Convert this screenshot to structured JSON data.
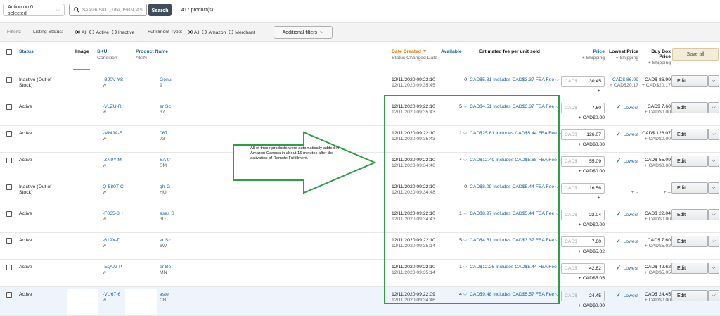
{
  "toolbar": {
    "action_dropdown": "Action on 0 selected",
    "search_placeholder": "Search SKU, Title, ISBN, AS",
    "search_button": "Search",
    "product_count": "417 product(s)"
  },
  "filters": {
    "label": "Filters:",
    "listing_status_label": "Listing Status:",
    "listing_options": [
      "All",
      "Active",
      "Inactive"
    ],
    "listing_selected": "All",
    "fulfillment_label": "Fulfillment Type:",
    "fulfillment_options": [
      "All",
      "Amazon",
      "Merchant"
    ],
    "fulfillment_selected": "All",
    "additional_filters": "Additional filters"
  },
  "columns": {
    "status": "Status",
    "image": "Image",
    "sku": "SKU",
    "sku_sub": "Condition",
    "product_name": "Product Name",
    "product_name_sub": "ASIN",
    "date_created": "Date Created",
    "date_created_sub": "Status Changed Date",
    "available": "Available",
    "fee": "Estimated fee per unit sold",
    "price": "Price",
    "price_sub": "+ Shipping",
    "lowest_price": "Lowest Price",
    "lowest_price_sub": "+ Shipping",
    "buy_box": "Buy Box Price",
    "buy_box_sub": "+ Shipping",
    "save_all": "Save all"
  },
  "annotation": "All of these products were automatically added in Amazon Canada in about 15 minutes after the activation of Remote Fulfillment.",
  "currency_placeholder": "CAD$",
  "edit_label": "Edit",
  "rows": [
    {
      "status": "Inactive (Out of Stock)",
      "sku": "-BJ0V-YS",
      "cond": "w",
      "name": "Genu",
      "asin": "9",
      "date": "12/11/2020 09:22:10",
      "changed": "12/11/2020 09:35:45",
      "avail": "0",
      "fee": "CAD$5.81 Includes CAD$3.37 FBA Fee",
      "price": "30.45",
      "ship": "+ --",
      "lowest": "CAD$ 86.99",
      "lowest_ship": "+ CAD$20.17",
      "buybox": "CAD$ 86.99",
      "buybox_ship": "+ CAD$20.17"
    },
    {
      "status": "Active",
      "sku": "-VLZU-R",
      "cond": "w",
      "name": "er Sc",
      "asin": "37",
      "date": "12/11/2020 09:22:10",
      "changed": "12/11/2020 09:35:43",
      "avail": "5",
      "fee": "CAD$4.51 Includes CAD$3.37 FBA Fee",
      "price": "7.60",
      "ship": "+ CAD$0.00",
      "lowest": "Lowest",
      "lowest_ship": "",
      "buybox": "CAD$ 7.60",
      "buybox_ship": "+ CAD$0.00"
    },
    {
      "status": "Active",
      "sku": "-MMJA-E",
      "cond": "w",
      "name": "0671",
      "asin": "73",
      "date": "12/11/2020 09:22:10",
      "changed": "12/11/2020 09:35:43",
      "avail": "1",
      "fee": "CAD$25.61 Includes CAD$5.44 FBA Fee",
      "price": "126.07",
      "ship": "+ CAD$0.00",
      "lowest": "Lowest",
      "lowest_ship": "",
      "buybox": "CAD$ 126.07",
      "buybox_ship": "+ CAD$0.00"
    },
    {
      "status": "Active",
      "sku": "-ZN9Y-M",
      "cond": "w",
      "name": "SA 0'",
      "asin": "SM",
      "date": "12/11/2020 09:22:10",
      "changed": "12/11/2020 09:34:46",
      "avail": "4",
      "fee": "CAD$12.49 Includes CAD$5.68 FBA Fee",
      "price": "55.09",
      "ship": "+ CAD$0.00",
      "lowest": "Lowest",
      "lowest_ship": "",
      "buybox": "CAD$ 55.09",
      "buybox_ship": "+ CAD$0.00"
    },
    {
      "status": "Inactive (Out of Stock)",
      "sku": "Q-580T-C",
      "cond": "w",
      "name": "gh-G",
      "asin": "HU",
      "date": "12/11/2020 09:22:10",
      "changed": "12/11/2020 09:34:48",
      "avail": "0",
      "fee": "CAD$8.09 Includes CAD$5.44 FBA Fee",
      "price": "16.56",
      "ship": "+ --",
      "lowest": "-",
      "lowest_ship": "+ --",
      "buybox": "-",
      "buybox_ship": "+ --"
    },
    {
      "status": "Active",
      "sku": "-F035-8H",
      "cond": "w",
      "name": "ases S",
      "asin": "3D",
      "date": "12/11/2020 09:22:10",
      "changed": "12/11/2020 09:34:43",
      "avail": "1",
      "fee": "CAD$8.97 Includes CAD$5.44 FBA Fee",
      "price": "22.04",
      "ship": "+ CAD$0.00",
      "lowest": "Lowest",
      "lowest_ship": "",
      "buybox": "CAD$ 22.04",
      "buybox_ship": "+ CAD$0.00"
    },
    {
      "status": "Active",
      "sku": "-619X-D",
      "cond": "w",
      "name": "er Sc",
      "asin": "6W",
      "date": "12/11/2020 09:22:10",
      "changed": "12/11/2020 09:35:14",
      "avail": "5",
      "fee": "CAD$4.51 Includes CAD$3.37 FBA Fee",
      "price": "7.60",
      "ship": "+ CAD$5.02",
      "lowest": "Lowest",
      "lowest_ship": "",
      "buybox": "CAD$ 7.60",
      "buybox_ship": "+ CAD$5.02"
    },
    {
      "status": "Active",
      "sku": "-EQU2-P",
      "cond": "w",
      "name": "er Be",
      "asin": "MN",
      "date": "12/11/2020 09:22:10",
      "changed": "12/11/2020 09:35:14",
      "avail": "1",
      "fee": "CAD$12.26 Includes CAD$5.44 FBA Fee",
      "price": "42.62",
      "ship": "+ CAD$5.05",
      "lowest": "Lowest",
      "lowest_ship": "",
      "buybox": "CAD$ 42.62",
      "buybox_ship": "+ CAD$5.05"
    },
    {
      "status": "Active",
      "sku": "-VU67-6",
      "cond": "w",
      "name": "aste",
      "asin": "CB",
      "date": "12/11/2020 09:22:09",
      "changed": "12/11/2020 09:34:46",
      "avail": "4",
      "fee": "CAD$9.48 Includes CAD$5.57 FBA Fee",
      "price": "24.45",
      "ship": "+ CAD$0.00",
      "lowest": "Lowest",
      "lowest_ship": "",
      "buybox": "CAD$ 24.45",
      "buybox_ship": "+ CAD$0.00"
    }
  ]
}
